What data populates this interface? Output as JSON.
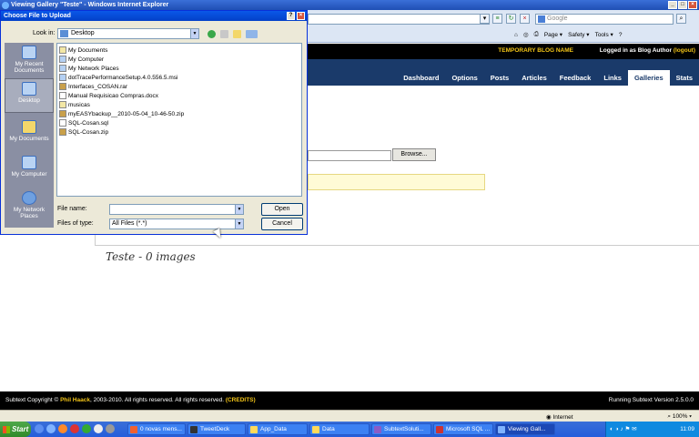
{
  "ie": {
    "window_title": "Viewing Gallery \"Teste\" - Windows Internet Explorer",
    "search_placeholder": "Google",
    "commands": [
      "Page ▾",
      "Safety ▾",
      "Tools ▾"
    ]
  },
  "blog": {
    "name": "TEMPORARY BLOG NAME",
    "logged_in": "Logged in as Blog Author",
    "logout": "(logout)",
    "tabs": [
      {
        "label": "Dashboard"
      },
      {
        "label": "Options"
      },
      {
        "label": "Posts"
      },
      {
        "label": "Articles"
      },
      {
        "label": "Feedback"
      },
      {
        "label": "Links"
      },
      {
        "label": "Galleries",
        "active": true
      },
      {
        "label": "Stats"
      }
    ],
    "browse_label": "Browse...",
    "gallery_title": "Teste - 0 images"
  },
  "footer": {
    "left_prefix": "Subtext Copyright ©",
    "author": "Phil Haack",
    "left_suffix": ", 2003-2010. All rights reserved. All rights reserved.",
    "credits": "(CREDITS)",
    "right": "Running Subtext Version 2.5.0.0"
  },
  "status": {
    "zone": "Internet",
    "zoom": "100%"
  },
  "taskbar": {
    "start": "Start",
    "tasks": [
      "0 novas mens...",
      "TweetDeck",
      "App_Data",
      "Data",
      "SubtextSoluti...",
      "Microsoft SQL ...",
      "Viewing Gall..."
    ],
    "active_index": 6,
    "clock": "11:09"
  },
  "dialog": {
    "title": "Choose File to Upload",
    "look_in_label": "Look in:",
    "look_in_value": "Desktop",
    "places": [
      "My Recent Documents",
      "Desktop",
      "My Documents",
      "My Computer",
      "My Network Places"
    ],
    "active_place": 1,
    "files": [
      {
        "name": "My Documents",
        "kind": "folder"
      },
      {
        "name": "My Computer",
        "kind": "system"
      },
      {
        "name": "My Network Places",
        "kind": "system"
      },
      {
        "name": "dotTracePerformanceSetup.4.0.556.5.msi",
        "kind": "file"
      },
      {
        "name": "Interfaces_COSAN.rar",
        "kind": "zip"
      },
      {
        "name": "Manual Requisicao Compras.docx",
        "kind": "doc"
      },
      {
        "name": "musicas",
        "kind": "folder"
      },
      {
        "name": "myEASYbackup__2010-05-04_10-46-50.zip",
        "kind": "zip"
      },
      {
        "name": "SQL-Cosan.sql",
        "kind": "doc"
      },
      {
        "name": "SQL-Cosan.zip",
        "kind": "zip"
      }
    ],
    "file_name_label": "File name:",
    "file_name_value": "",
    "file_type_label": "Files of type:",
    "file_type_value": "All Files (*.*)",
    "open_label": "Open",
    "cancel_label": "Cancel"
  }
}
